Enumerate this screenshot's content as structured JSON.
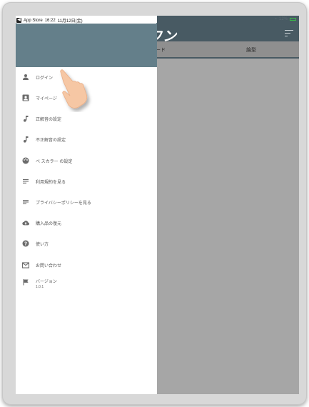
{
  "status_bar": {
    "back_label": "App Store",
    "time": "16:22",
    "date": "11月12日(金)",
    "battery": "12%"
  },
  "background_app": {
    "title": "ワン",
    "columns": [
      "ード",
      "論型"
    ]
  },
  "drawer": {
    "items": [
      {
        "label": "ログイン",
        "icon": "person-icon"
      },
      {
        "label": "マイページ",
        "icon": "account-box-icon"
      },
      {
        "label": "正解音の設定",
        "icon": "music-note-icon"
      },
      {
        "label": "不正解音の設定",
        "icon": "music-note-icon"
      },
      {
        "label": "ベ スカラー の設定",
        "icon": "palette-icon"
      },
      {
        "label": "利用規約を見る",
        "icon": "document-lines-icon"
      },
      {
        "label": "プライバシーポリシーを見る",
        "icon": "document-lines-icon"
      },
      {
        "label": "購入品の復元",
        "icon": "cloud-upload-icon"
      },
      {
        "label": "使い方",
        "icon": "help-circle-icon"
      },
      {
        "label": "お問い合わせ",
        "icon": "mail-icon"
      },
      {
        "label": "バージョン",
        "sub": "1.0.1",
        "icon": "flag-icon"
      }
    ]
  }
}
